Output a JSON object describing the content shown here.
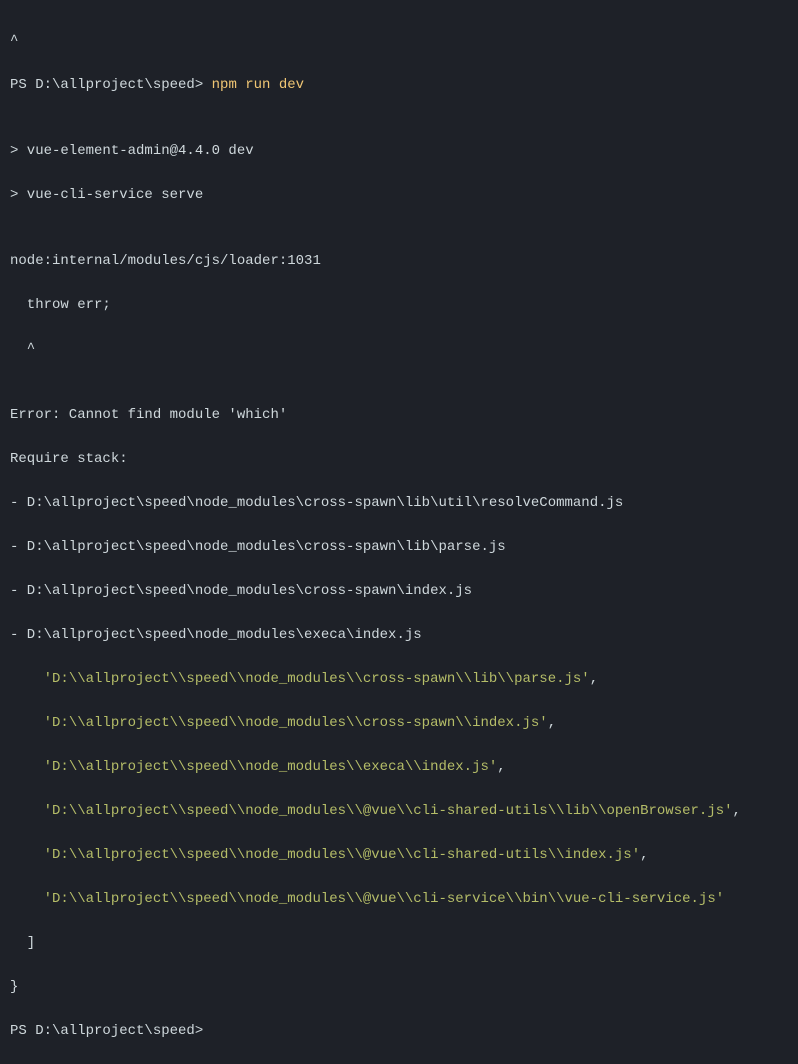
{
  "caret": "^",
  "prompt1": {
    "path": "PS D:\\allproject\\speed> ",
    "command": "npm run dev"
  },
  "blank": "",
  "run1": "> vue-element-admin@4.4.0 dev",
  "run2": "> vue-cli-service serve",
  "loader1": "node:internal/modules/cjs/loader:1031",
  "loader2": "  throw err;",
  "loader3": "  ^",
  "error1": "Error: Cannot find module 'which'",
  "error2": "Require stack:",
  "stack1": "- D:\\allproject\\speed\\node_modules\\cross-spawn\\lib\\util\\resolveCommand.js",
  "stack2": "- D:\\allproject\\speed\\node_modules\\cross-spawn\\lib\\parse.js",
  "stack3": "- D:\\allproject\\speed\\node_modules\\cross-spawn\\index.js",
  "stack4": "- D:\\allproject\\speed\\node_modules\\execa\\index.js",
  "path1_pre": "    ",
  "path1": "'D:\\\\allproject\\\\speed\\\\node_modules\\\\cross-spawn\\\\lib\\\\parse.js'",
  "path1_post": ",",
  "path2_pre": "    ",
  "path2": "'D:\\\\allproject\\\\speed\\\\node_modules\\\\cross-spawn\\\\index.js'",
  "path2_post": ",",
  "path3_pre": "    ",
  "path3": "'D:\\\\allproject\\\\speed\\\\node_modules\\\\execa\\\\index.js'",
  "path3_post": ",",
  "path4_pre": "    ",
  "path4": "'D:\\\\allproject\\\\speed\\\\node_modules\\\\@vue\\\\cli-shared-utils\\\\lib\\\\openBrowser.js'",
  "path4_post": ",",
  "path5_pre": "    ",
  "path5": "'D:\\\\allproject\\\\speed\\\\node_modules\\\\@vue\\\\cli-shared-utils\\\\index.js'",
  "path5_post": ",",
  "path6_pre": "    ",
  "path6": "'D:\\\\allproject\\\\speed\\\\node_modules\\\\@vue\\\\cli-service\\\\bin\\\\vue-cli-service.js'",
  "closebracket": "  ]",
  "closebrace": "}",
  "prompt2": {
    "path": "PS D:\\allproject\\speed>"
  }
}
